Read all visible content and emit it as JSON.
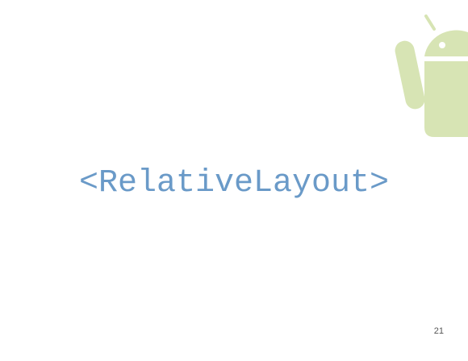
{
  "slide": {
    "title": "<RelativeLayout>",
    "page_number": "21"
  },
  "logo": {
    "icon": "android-robot-icon",
    "color": "#d7e4b4"
  },
  "colors": {
    "title": "#6a9ac8",
    "background": "#ffffff"
  }
}
